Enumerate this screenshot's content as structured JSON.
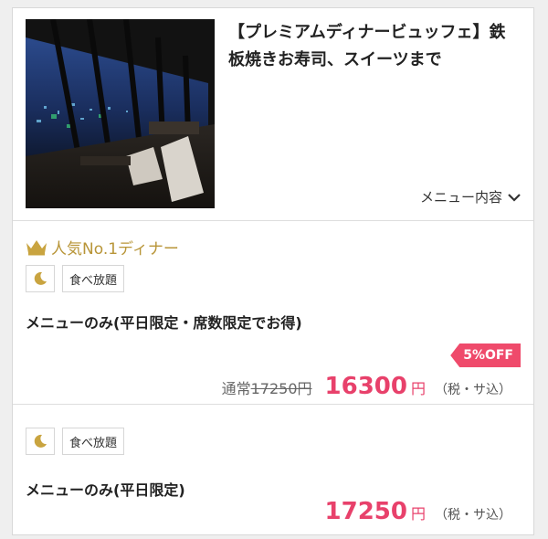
{
  "header": {
    "title": "【プレミアムディナービュッフェ】鉄板焼きお寿司、スイーツまで",
    "menu_toggle_label": "メニュー内容"
  },
  "plans": [
    {
      "badge": "人気No.1ディナー",
      "tag_moon_icon": "moon-icon",
      "tag_label": "食べ放題",
      "name": "メニューのみ(平日限定・席数限定でお得)",
      "discount": "5%OFF",
      "regular_prefix": "通常",
      "regular_price": "17250円",
      "price": "16300",
      "yen": "円",
      "tax": "（税・サ込）"
    },
    {
      "tag_moon_icon": "moon-icon",
      "tag_label": "食べ放題",
      "name": "メニューのみ(平日限定)",
      "price": "17250",
      "yen": "円",
      "tax": "（税・サ込）"
    }
  ],
  "colors": {
    "accent_price": "#e8416b",
    "badge_gold": "#b89538",
    "discount_bg": "#ef4a6b"
  }
}
